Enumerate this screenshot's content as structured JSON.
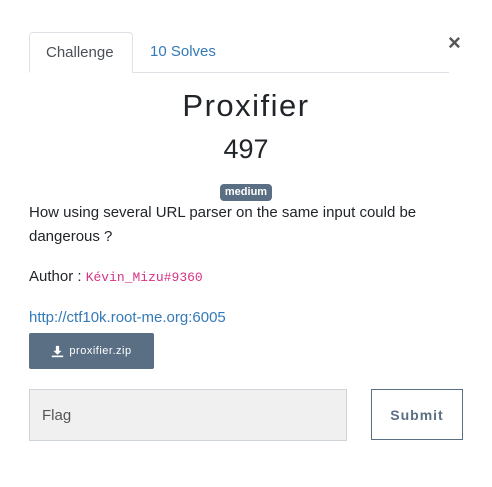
{
  "tabs": [
    {
      "label": "Challenge",
      "active": true
    },
    {
      "label": "10 Solves",
      "active": false
    }
  ],
  "close_label": "×",
  "challenge": {
    "name": "Proxifier",
    "points": "497",
    "difficulty": "medium",
    "description": "How using several URL parser on the same input could be dangerous ?",
    "author_prefix": "Author : ",
    "author": "Kévin_Mizu#9360",
    "link": "http://ctf10k.root-me.org:6005",
    "file_label": "proxifier.zip"
  },
  "form": {
    "flag_placeholder": "Flag",
    "submit_label": "Submit"
  },
  "colors": {
    "accent": "#5a6e84",
    "link": "#337ab7",
    "author_code": "#d63384"
  },
  "icons": {
    "download": "download-icon",
    "close": "close-icon"
  }
}
